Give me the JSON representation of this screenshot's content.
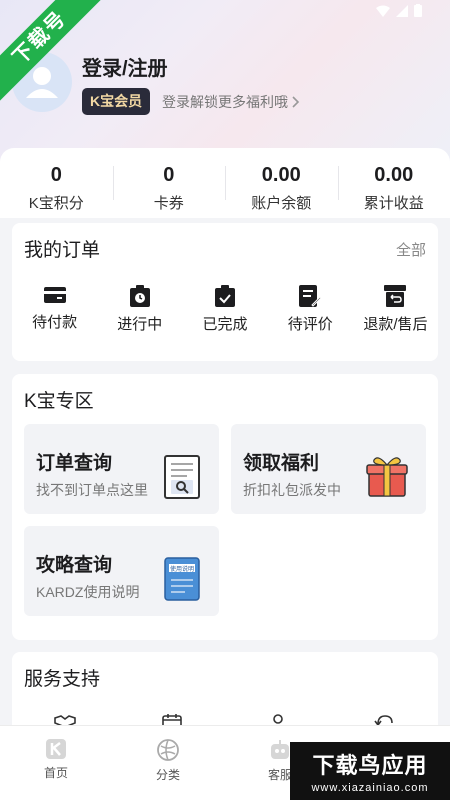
{
  "watermark": {
    "ribbon": "下载号",
    "big": "下载鸟应用",
    "url": "www.xiazainiao.com"
  },
  "profile": {
    "title": "登录/注册",
    "badge": "K宝会员",
    "promo": "登录解锁更多福利哦"
  },
  "stats": [
    {
      "value": "0",
      "label": "K宝积分"
    },
    {
      "value": "0",
      "label": "卡券"
    },
    {
      "value": "0.00",
      "label": "账户余额"
    },
    {
      "value": "0.00",
      "label": "累计收益"
    }
  ],
  "orders": {
    "title": "我的订单",
    "see_all": "全部",
    "items": [
      {
        "label": "待付款",
        "icon": "card-icon"
      },
      {
        "label": "进行中",
        "icon": "clock-clipboard-icon"
      },
      {
        "label": "已完成",
        "icon": "check-clipboard-icon"
      },
      {
        "label": "待评价",
        "icon": "edit-note-icon"
      },
      {
        "label": "退款/售后",
        "icon": "return-box-icon"
      }
    ]
  },
  "kzone": {
    "title": "K宝专区",
    "tiles": [
      {
        "title": "订单查询",
        "subtitle": "找不到订单点这里",
        "icon": "magnifier-doc-icon"
      },
      {
        "title": "领取福利",
        "subtitle": "折扣礼包派发中",
        "icon": "gift-icon"
      },
      {
        "title": "攻略查询",
        "subtitle": "KARDZ使用说明",
        "icon": "manual-book-icon"
      }
    ],
    "manual_cover_text": "使用说明"
  },
  "service": {
    "title": "服务支持"
  },
  "tabs": [
    {
      "label": "首页",
      "icon": "home-k-icon"
    },
    {
      "label": "分类",
      "icon": "category-icon"
    },
    {
      "label": "客服",
      "icon": "robot-icon"
    }
  ],
  "colors": {
    "ribbon": "#22b14c",
    "badge_bg": "#2a2b3a",
    "badge_text": "#f3d9a4",
    "gift": "#e85a4f"
  }
}
